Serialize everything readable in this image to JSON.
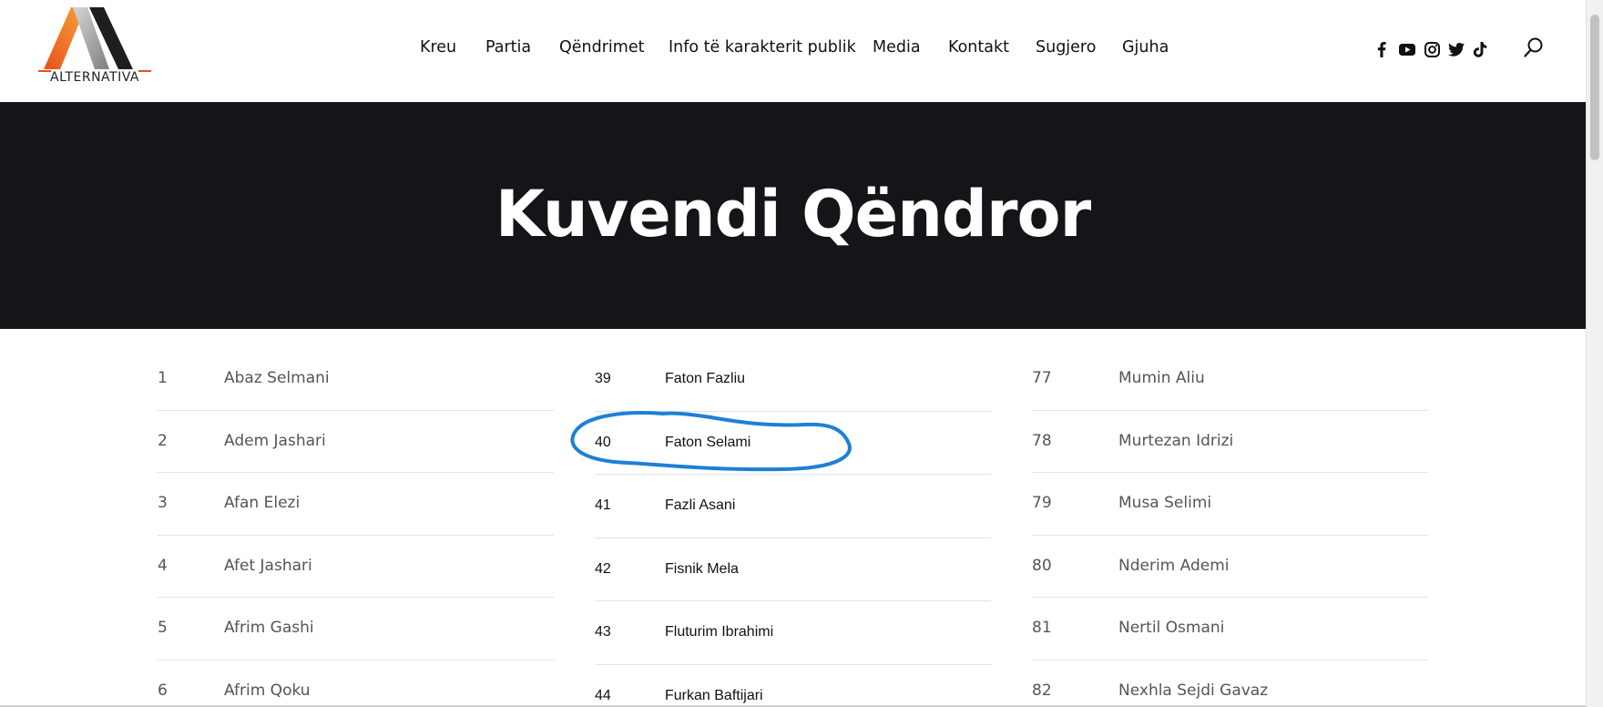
{
  "brand": {
    "name": "ALTERNATIVA",
    "colors": {
      "orange": "#e8501c",
      "gray": "#9a9a9a",
      "black": "#1a1a1a"
    }
  },
  "nav": {
    "items": [
      "Kreu",
      "Partia",
      "Qëndrimet",
      "Info të karakterit publik",
      "Media",
      "Kontakt",
      "Sugjero",
      "Gjuha"
    ]
  },
  "social": [
    "facebook-icon",
    "youtube-icon",
    "instagram-icon",
    "twitter-icon",
    "tiktok-icon"
  ],
  "search": {
    "icon": "search-icon"
  },
  "hero": {
    "title": "Kuvendi Qëndror",
    "background": "#141519"
  },
  "members": {
    "col1": [
      {
        "num": "1",
        "name": "Abaz Selmani"
      },
      {
        "num": "2",
        "name": "Adem Jashari"
      },
      {
        "num": "3",
        "name": "Afan Elezi"
      },
      {
        "num": "4",
        "name": "Afet Jashari"
      },
      {
        "num": "5",
        "name": "Afrim Gashi"
      },
      {
        "num": "6",
        "name": "Afrim Qoku"
      }
    ],
    "col2": [
      {
        "num": "39",
        "name": "Faton Fazliu"
      },
      {
        "num": "40",
        "name": "Faton Selami"
      },
      {
        "num": "41",
        "name": "Fazli Asani"
      },
      {
        "num": "42",
        "name": "Fisnik Mela"
      },
      {
        "num": "43",
        "name": "Fluturim Ibrahimi"
      },
      {
        "num": "44",
        "name": "Furkan Baftijari"
      }
    ],
    "col3": [
      {
        "num": "77",
        "name": "Mumin Aliu"
      },
      {
        "num": "78",
        "name": "Murtezan Idrizi"
      },
      {
        "num": "79",
        "name": "Musa Selimi"
      },
      {
        "num": "80",
        "name": "Nderim Ademi"
      },
      {
        "num": "81",
        "name": "Nertil Osmani"
      },
      {
        "num": "82",
        "name": "Nexhla Sejdi Gavaz"
      }
    ]
  },
  "annotation": {
    "color": "#1e7fd6",
    "circled_entry": "40"
  }
}
